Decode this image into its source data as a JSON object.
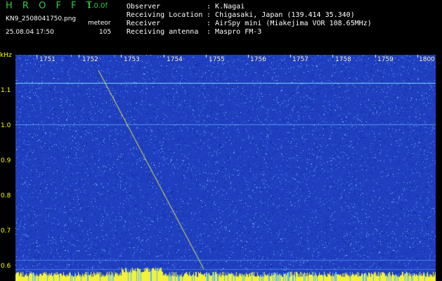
{
  "header": {
    "app_title": "H R O F F T",
    "version": "1.0.0f",
    "filename": "KN9_2508041750.png",
    "mode": "meteor",
    "datetime": "25.08.04 17:50",
    "count": "105",
    "fields": [
      {
        "label": "Observer",
        "value": "K.Nagai"
      },
      {
        "label": "Receiving Location",
        "value": "Chigasaki, Japan (139.414 35.340)"
      },
      {
        "label": "Receiver",
        "value": "AirSpy mini (Miakejima VOR 108.65MHz)"
      },
      {
        "label": "Receiving antenna",
        "value": "Maspro FM-3"
      }
    ]
  },
  "axis": {
    "unit": "kHz",
    "y_labels": [
      "1.1",
      "1.0",
      "0.9",
      "0.8",
      "0.7",
      "0.6"
    ],
    "x_labels": [
      "1751",
      "1752",
      "1753",
      "1754",
      "1755",
      "1756",
      "1757",
      "1758",
      "1759",
      "1800"
    ]
  },
  "colors": {
    "background": "#000000",
    "waterfall": "#1f3fc0",
    "noise": "#6fb8ff",
    "trace": "#e8f040",
    "title": "#2ecc40",
    "axis": "#ffff00"
  }
}
